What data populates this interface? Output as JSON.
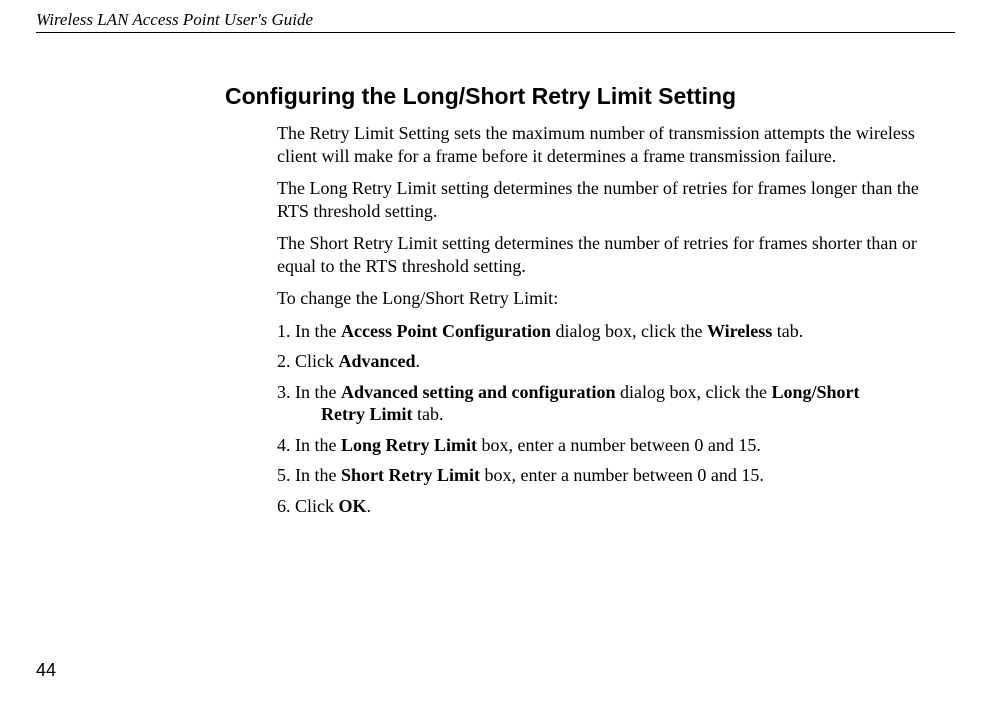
{
  "header": {
    "bookTitle": "Wireless LAN Access Point User's Guide"
  },
  "section": {
    "title": "Configuring the Long/Short Retry Limit Setting",
    "p1": "The Retry Limit Setting sets the maximum number of transmission attempts the wireless client will make for a frame before it determines a frame transmission failure.",
    "p2": "The Long Retry Limit setting determines the number of retries for frames longer than the RTS threshold setting.",
    "p3": "The Short Retry Limit setting determines the number of retries for frames shorter than or equal to the RTS threshold setting.",
    "p4": "To change the Long/Short Retry Limit:",
    "step1_pre": "In the ",
    "step1_b1": "Access Point Configuration",
    "step1_mid": " dialog box, click the ",
    "step1_b2": "Wireless",
    "step1_post": " tab.",
    "step2_pre": "Click ",
    "step2_b1": "Advanced",
    "step2_post": ".",
    "step3_pre": "In the ",
    "step3_b1": "Advanced setting and configuration",
    "step3_mid": " dialog box, click the ",
    "step3_b2": "Long/Short",
    "step3_line2_b": "Retry Limit",
    "step3_line2_post": " tab.",
    "step4_pre": "In the ",
    "step4_b1": "Long Retry Limit",
    "step4_post": " box, enter a number between 0 and 15.",
    "step5_pre": "In the ",
    "step5_b1": "Short Retry Limit",
    "step5_post": " box, enter a number between 0 and 15.",
    "step6_pre": "Click ",
    "step6_b1": "OK",
    "step6_post": "."
  },
  "pageNumber": "44"
}
